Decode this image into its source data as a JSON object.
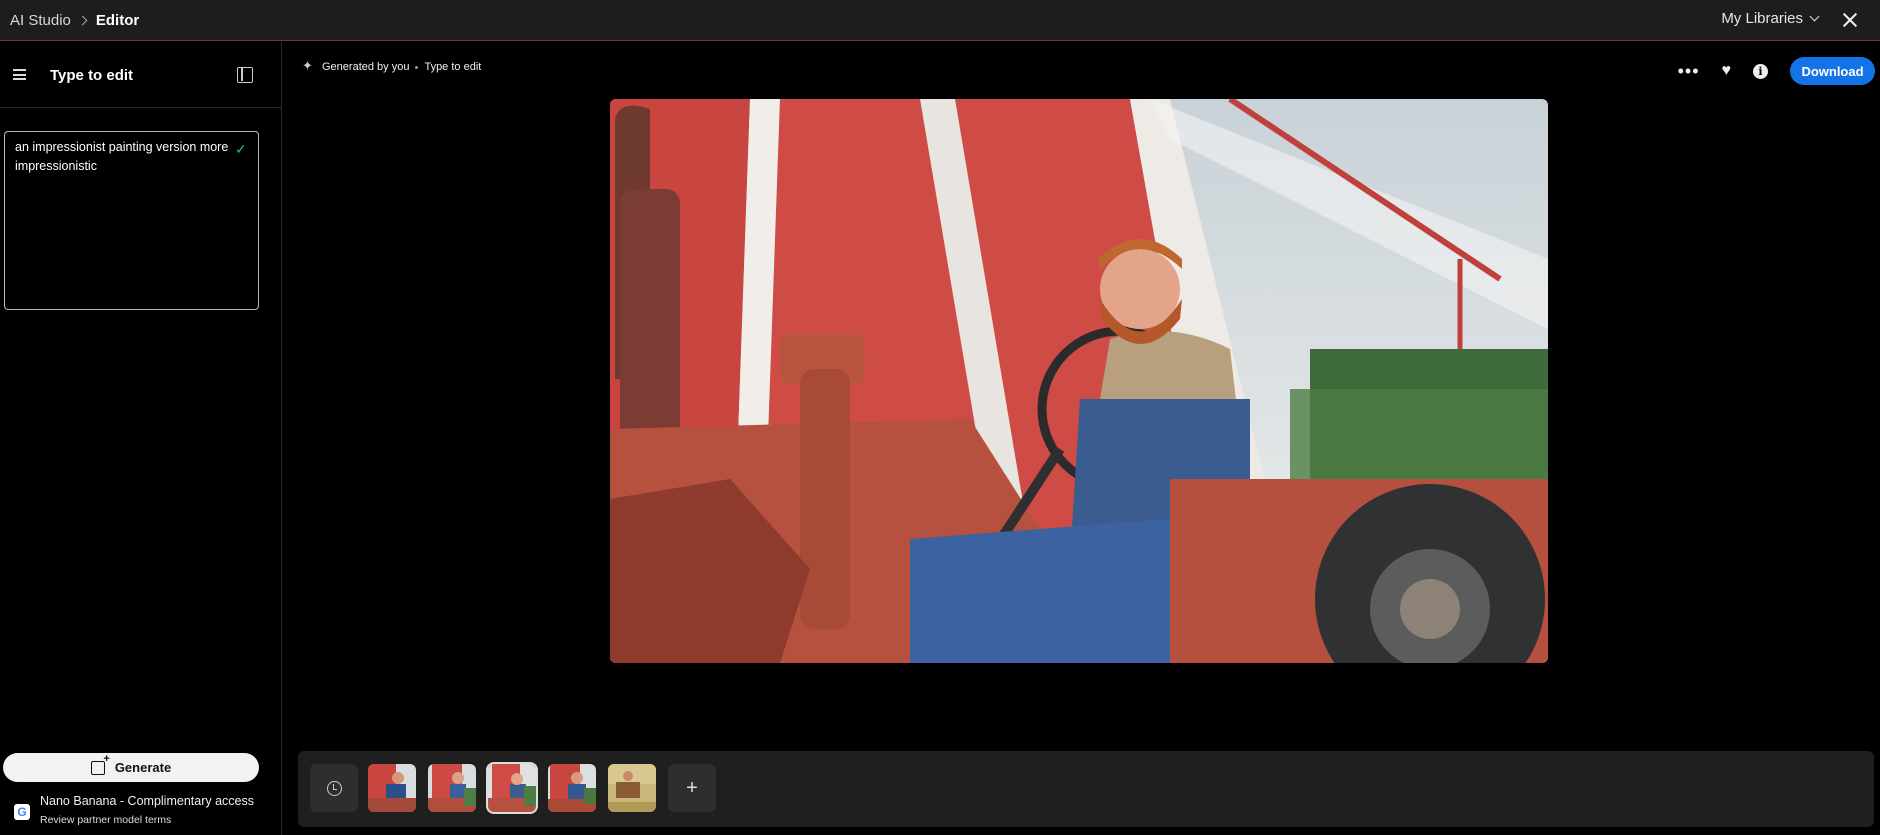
{
  "topbar": {
    "breadcrumb_root": "AI Studio",
    "breadcrumb_current": "Editor",
    "libraries_label": "My Libraries"
  },
  "sidebar": {
    "title": "Type to edit",
    "prompt_text": "an impressionist painting version  more impressionistic",
    "generate_label": "Generate",
    "model_name": "Nano Banana - Complimentary access",
    "model_terms": "Review partner model terms"
  },
  "canvas": {
    "meta_source": "Generated by you",
    "meta_mode": "Type to edit",
    "download_label": "Download"
  },
  "colors": {
    "accent": "#1473e6",
    "check": "#33c06b"
  },
  "icons": [
    "hamburger-icon",
    "panel-toggle-icon",
    "check-icon",
    "generate-icon",
    "google-icon",
    "sparkle-icon",
    "more-icon",
    "heart-icon",
    "info-icon",
    "history-icon",
    "add-icon",
    "close-icon",
    "chevron-down-icon"
  ]
}
